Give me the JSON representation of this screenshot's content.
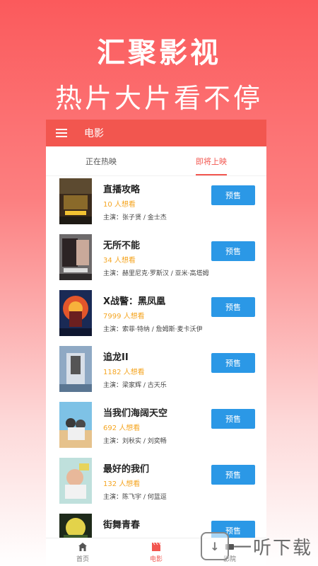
{
  "hero": {
    "title": "汇聚影视",
    "subtitle": "热片大片看不停"
  },
  "appbar": {
    "title": "电影"
  },
  "tabs": [
    {
      "label": "正在热映",
      "active": false
    },
    {
      "label": "即将上映",
      "active": true
    }
  ],
  "movies": [
    {
      "title": "直播攻略",
      "want": "10 人想看",
      "cast": "主演：张子贤 / 金士杰",
      "button": "预售"
    },
    {
      "title": "无所不能",
      "want": "34 人想看",
      "cast": "主演：赫里尼克·罗斯汉 / 亚米·高塔姆",
      "button": "预售"
    },
    {
      "title": "X战警：黑凤凰",
      "want": "7999 人想看",
      "cast": "主演：索菲·特纳 / 詹姆斯·麦卡沃伊",
      "button": "预售"
    },
    {
      "title": "追龙II",
      "want": "1182 人想看",
      "cast": "主演：梁家辉 / 古天乐",
      "button": "预售"
    },
    {
      "title": "当我们海阔天空",
      "want": "692 人想看",
      "cast": "主演：刘秋实 / 刘奕畅",
      "button": "预售"
    },
    {
      "title": "最好的我们",
      "want": "132 人想看",
      "cast": "主演：陈飞宇 / 何蓝逗",
      "button": "预售"
    },
    {
      "title": "街舞青春",
      "want": "",
      "cast": "",
      "button": "预售"
    }
  ],
  "bottom_nav": [
    {
      "label": "首页",
      "icon": "home-icon",
      "active": false
    },
    {
      "label": "电影",
      "icon": "clapperboard-icon",
      "active": true
    },
    {
      "label": "影院",
      "icon": "cinema-icon",
      "active": false
    }
  ],
  "watermark": {
    "text": "一听下载"
  },
  "colors": {
    "accent": "#f2564f",
    "button": "#2b98e6",
    "want": "#f5a623"
  }
}
